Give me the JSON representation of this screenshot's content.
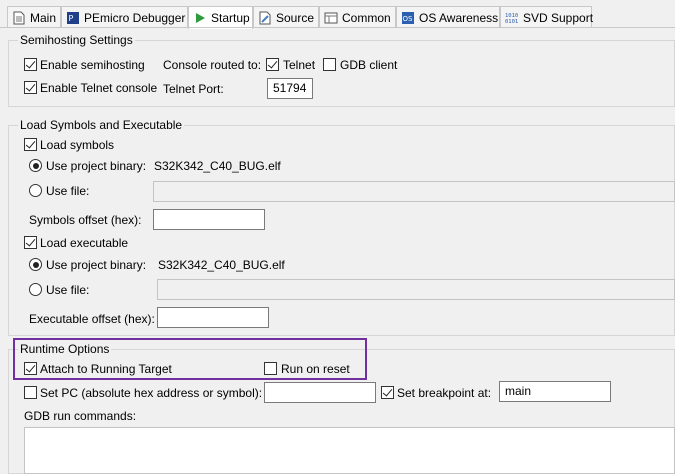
{
  "tabs": [
    {
      "label": "Main",
      "icon": "document-icon",
      "active": false
    },
    {
      "label": "PEmicro Debugger",
      "icon": "pemicro-icon",
      "active": false
    },
    {
      "label": "Startup",
      "icon": "play-icon",
      "active": true
    },
    {
      "label": "Source",
      "icon": "source-icon",
      "active": false
    },
    {
      "label": "Common",
      "icon": "common-icon",
      "active": false
    },
    {
      "label": "OS Awareness",
      "icon": "os-icon",
      "active": false
    },
    {
      "label": "SVD Support",
      "icon": "binary-icon",
      "active": false
    }
  ],
  "semihosting": {
    "title": "Semihosting Settings",
    "enable_semihosting": {
      "label": "Enable semihosting",
      "checked": true
    },
    "enable_telnet": {
      "label": "Enable Telnet console",
      "checked": true
    },
    "console_routed_label": "Console routed to:",
    "telnet": {
      "label": "Telnet",
      "checked": true
    },
    "gdb_client": {
      "label": "GDB client",
      "checked": false
    },
    "telnet_port_label": "Telnet Port:",
    "telnet_port_value": "51794"
  },
  "load": {
    "title": "Load Symbols and Executable",
    "load_symbols": {
      "label": "Load symbols",
      "checked": true
    },
    "symbols_use_project": {
      "label": "Use project binary:",
      "selected": true,
      "value": "S32K342_C40_BUG.elf"
    },
    "symbols_use_file": {
      "label": "Use file:",
      "selected": false,
      "value": ""
    },
    "symbols_offset_label": "Symbols offset (hex):",
    "symbols_offset_value": "",
    "load_executable": {
      "label": "Load executable",
      "checked": true
    },
    "exec_use_project": {
      "label": "Use project binary:",
      "selected": true,
      "value": "S32K342_C40_BUG.elf"
    },
    "exec_use_file": {
      "label": "Use file:",
      "selected": false,
      "value": ""
    },
    "exec_offset_label": "Executable offset (hex):",
    "exec_offset_value": ""
  },
  "runtime": {
    "title": "Runtime Options",
    "attach": {
      "label": "Attach to Running Target",
      "checked": true
    },
    "run_on_reset": {
      "label": "Run on reset",
      "checked": false
    },
    "set_pc": {
      "label": "Set PC (absolute hex address or symbol):",
      "checked": false,
      "value": ""
    },
    "set_breakpoint": {
      "label": "Set breakpoint at:",
      "checked": true,
      "value": "main"
    },
    "gdb_run_commands_label": "GDB run commands:",
    "gdb_run_commands_value": ""
  },
  "colors": {
    "highlight": "#7030a0"
  }
}
